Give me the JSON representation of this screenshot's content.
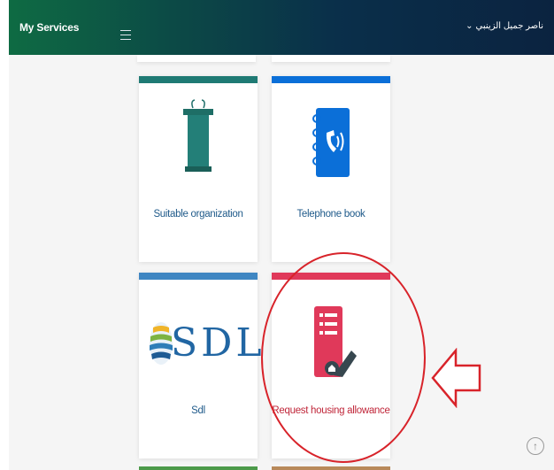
{
  "header": {
    "app_title": "My Services",
    "user_name": "ناصر جميل الزينبي",
    "user_caret": "⌄"
  },
  "services": [
    {
      "label": "Suitable organization",
      "accent": "#1f7a74",
      "icon": "podium-icon"
    },
    {
      "label": "Telephone book",
      "accent": "#0b6fd8",
      "icon": "phone-book-icon"
    },
    {
      "label": "Sdl",
      "accent": "#3f86c2",
      "icon": "sdl-logo",
      "logo_text": "SDL"
    },
    {
      "label": "Request housing allowance",
      "accent": "#e0395a",
      "icon": "housing-request-icon"
    }
  ],
  "colors": {
    "annotation_red": "#d8232a",
    "label_blue": "#1f5a8a"
  },
  "scroll_top_icon": "↑"
}
